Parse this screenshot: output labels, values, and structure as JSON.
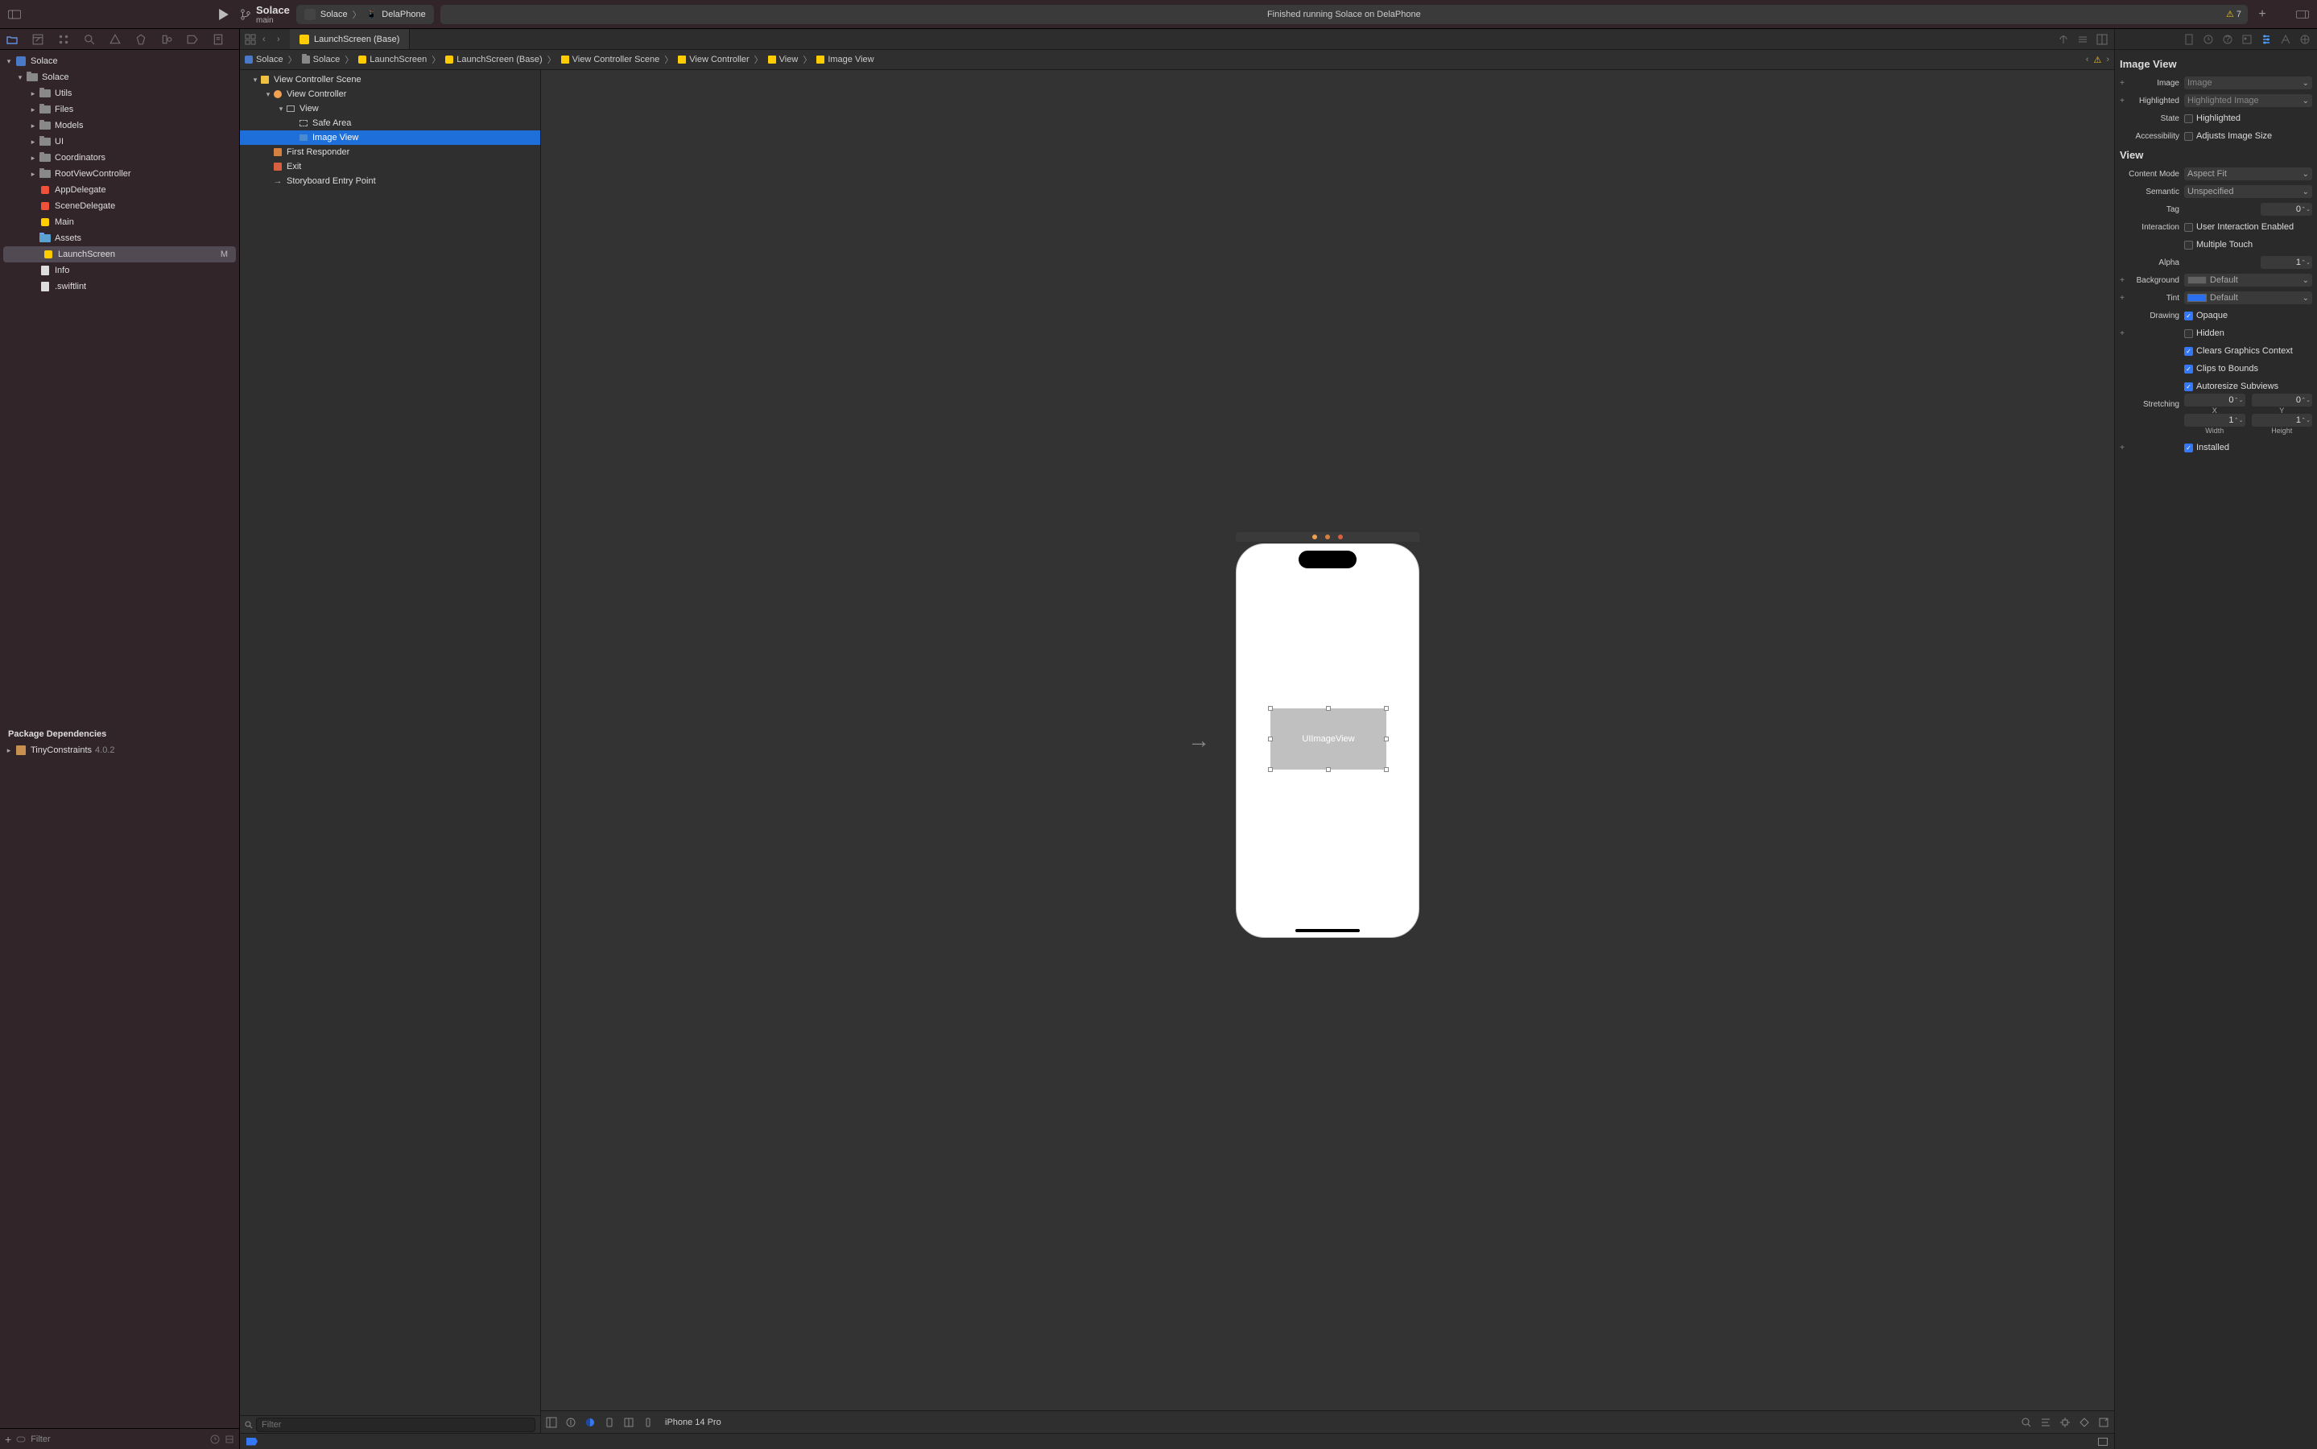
{
  "toolbar": {
    "project_name": "Solace",
    "branch_name": "main",
    "scheme": "Solace",
    "destination": "DelaPhone",
    "status_text": "Finished running Solace on DelaPhone",
    "warning_count": "7"
  },
  "navigator": {
    "tree": [
      {
        "indent": 0,
        "disclosure": "▾",
        "icon": "app",
        "label": "Solace"
      },
      {
        "indent": 1,
        "disclosure": "▾",
        "icon": "folder-gray",
        "label": "Solace"
      },
      {
        "indent": 2,
        "disclosure": "▸",
        "icon": "folder-gray",
        "label": "Utils"
      },
      {
        "indent": 2,
        "disclosure": "▸",
        "icon": "folder-gray",
        "label": "Files"
      },
      {
        "indent": 2,
        "disclosure": "▸",
        "icon": "folder-gray",
        "label": "Models"
      },
      {
        "indent": 2,
        "disclosure": "▸",
        "icon": "folder-gray",
        "label": "UI"
      },
      {
        "indent": 2,
        "disclosure": "▸",
        "icon": "folder-gray",
        "label": "Coordinators"
      },
      {
        "indent": 2,
        "disclosure": "▸",
        "icon": "folder-gray",
        "label": "RootViewController"
      },
      {
        "indent": 2,
        "disclosure": "",
        "icon": "swift",
        "label": "AppDelegate"
      },
      {
        "indent": 2,
        "disclosure": "",
        "icon": "swift",
        "label": "SceneDelegate"
      },
      {
        "indent": 2,
        "disclosure": "",
        "icon": "story",
        "label": "Main"
      },
      {
        "indent": 2,
        "disclosure": "",
        "icon": "assets",
        "label": "Assets"
      },
      {
        "indent": 2,
        "disclosure": "",
        "icon": "story",
        "label": "LaunchScreen",
        "selected": true,
        "badge": "M"
      },
      {
        "indent": 2,
        "disclosure": "",
        "icon": "plist",
        "label": "Info"
      },
      {
        "indent": 2,
        "disclosure": "",
        "icon": "plist",
        "label": ".swiftlint"
      }
    ],
    "package_section_header": "Package Dependencies",
    "packages": [
      {
        "label": "TinyConstraints",
        "version": "4.0.2"
      }
    ],
    "filter_placeholder": "Filter"
  },
  "tabbar": {
    "active_tab_label": "LaunchScreen (Base)"
  },
  "jumpbar": {
    "crumbs": [
      "Solace",
      "Solace",
      "LaunchScreen",
      "LaunchScreen (Base)",
      "View Controller Scene",
      "View Controller",
      "View",
      "Image View"
    ]
  },
  "outline": {
    "rows": [
      {
        "indent": 0,
        "disclosure": "▾",
        "icon": "scene",
        "label": "View Controller Scene"
      },
      {
        "indent": 1,
        "disclosure": "▾",
        "icon": "vc",
        "label": "View Controller"
      },
      {
        "indent": 2,
        "disclosure": "▾",
        "icon": "view",
        "label": "View"
      },
      {
        "indent": 3,
        "disclosure": "",
        "icon": "safe",
        "label": "Safe Area"
      },
      {
        "indent": 3,
        "disclosure": "",
        "icon": "img",
        "label": "Image View",
        "selected": true
      },
      {
        "indent": 1,
        "disclosure": "",
        "icon": "first",
        "label": "First Responder"
      },
      {
        "indent": 1,
        "disclosure": "",
        "icon": "exit",
        "label": "Exit"
      },
      {
        "indent": 1,
        "disclosure": "",
        "icon": "entry",
        "label": "Storyboard Entry Point"
      }
    ],
    "filter_placeholder": "Filter"
  },
  "canvas": {
    "placed_view_label": "UIImageView",
    "device_name": "iPhone 14 Pro"
  },
  "inspector": {
    "section_imageview": "Image View",
    "section_view": "View",
    "image_label": "Image",
    "image_placeholder": "Image",
    "highlighted_label": "Highlighted",
    "highlighted_placeholder": "Highlighted Image",
    "state_label": "State",
    "state_highlighted": "Highlighted",
    "accessibility_label": "Accessibility",
    "accessibility_adjusts": "Adjusts Image Size",
    "content_mode_label": "Content Mode",
    "content_mode_value": "Aspect Fit",
    "semantic_label": "Semantic",
    "semantic_value": "Unspecified",
    "tag_label": "Tag",
    "tag_value": "0",
    "interaction_label": "Interaction",
    "interaction_user": "User Interaction Enabled",
    "interaction_multi": "Multiple Touch",
    "alpha_label": "Alpha",
    "alpha_value": "1",
    "background_label": "Background",
    "background_value": "Default",
    "tint_label": "Tint",
    "tint_value": "Default",
    "drawing_label": "Drawing",
    "drawing_opaque": "Opaque",
    "drawing_hidden": "Hidden",
    "drawing_clears": "Clears Graphics Context",
    "drawing_clips": "Clips to Bounds",
    "drawing_autoresize": "Autoresize Subviews",
    "stretching_label": "Stretching",
    "stretch_x": "0",
    "stretch_y": "0",
    "stretch_x_lbl": "X",
    "stretch_y_lbl": "Y",
    "stretch_w": "1",
    "stretch_h": "1",
    "stretch_w_lbl": "Width",
    "stretch_h_lbl": "Height",
    "installed_label": "Installed"
  }
}
